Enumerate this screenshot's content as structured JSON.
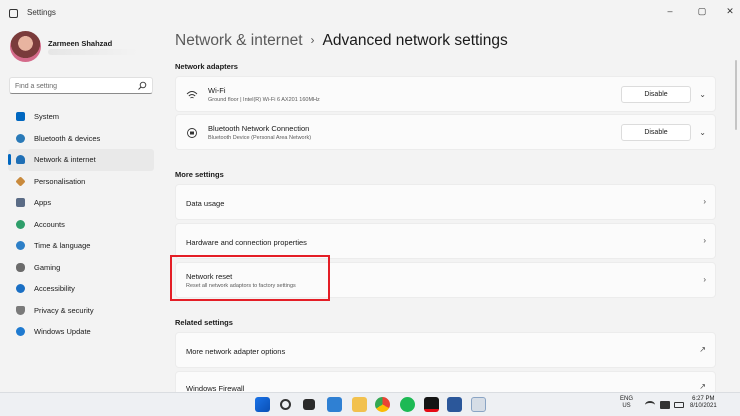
{
  "window": {
    "title": "Settings",
    "controls": [
      "–",
      "▢",
      "✕"
    ]
  },
  "profile": {
    "name": "Zarmeen Shahzad"
  },
  "search": {
    "placeholder": "Find a setting"
  },
  "sidebar": {
    "items": [
      {
        "label": "System",
        "icon": "system-icon",
        "color": "#0067c0"
      },
      {
        "label": "Bluetooth & devices",
        "icon": "bluetooth-icon",
        "color": "#2a7ab8"
      },
      {
        "label": "Network & internet",
        "icon": "wifi-icon",
        "color": "#1f6fb5",
        "active": true
      },
      {
        "label": "Personalisation",
        "icon": "brush-icon",
        "color": "#c98a3c"
      },
      {
        "label": "Apps",
        "icon": "apps-icon",
        "color": "#5a6b85"
      },
      {
        "label": "Accounts",
        "icon": "person-icon",
        "color": "#2e9e6a"
      },
      {
        "label": "Time & language",
        "icon": "globe-icon",
        "color": "#2d7fc7"
      },
      {
        "label": "Gaming",
        "icon": "controller-icon",
        "color": "#6b6b6b"
      },
      {
        "label": "Accessibility",
        "icon": "accessibility-icon",
        "color": "#1a6fc4"
      },
      {
        "label": "Privacy & security",
        "icon": "shield-icon",
        "color": "#7a7a7a"
      },
      {
        "label": "Windows Update",
        "icon": "update-icon",
        "color": "#1f7ad0"
      }
    ]
  },
  "breadcrumb": {
    "parent": "Network & internet",
    "separator": "›",
    "current": "Advanced network settings"
  },
  "sections": {
    "adapters": "Network adapters",
    "more": "More settings",
    "related": "Related settings"
  },
  "adapters": [
    {
      "title": "Wi-Fi",
      "subtitle": "Ground floor | Intel(R) Wi-Fi 6 AX201 160MHz",
      "button": "Disable",
      "icon": "wifi-icon"
    },
    {
      "title": "Bluetooth Network Connection",
      "subtitle": "Bluetooth Device (Personal Area Network)",
      "button": "Disable",
      "icon": "ethernet-icon"
    }
  ],
  "more_settings": [
    {
      "title": "Data usage"
    },
    {
      "title": "Hardware and connection properties"
    },
    {
      "title": "Network reset",
      "subtitle": "Reset all network adaptors to factory settings"
    }
  ],
  "related_settings": [
    {
      "title": "More network adapter options"
    },
    {
      "title": "Windows Firewall"
    }
  ],
  "taskbar": {
    "lang_top": "ENG",
    "lang_bottom": "US",
    "time": "6:27 PM",
    "date": "8/10/2021",
    "apps": [
      "windows-start-icon",
      "search-icon",
      "task-view-icon",
      "widgets-icon",
      "file-explorer-icon",
      "mail-icon",
      "chrome-icon",
      "spotify-icon",
      "netflix-icon",
      "word-icon",
      "settings-icon"
    ]
  },
  "colors": {
    "accent": "#0067c0",
    "highlight": "#e41e26"
  }
}
